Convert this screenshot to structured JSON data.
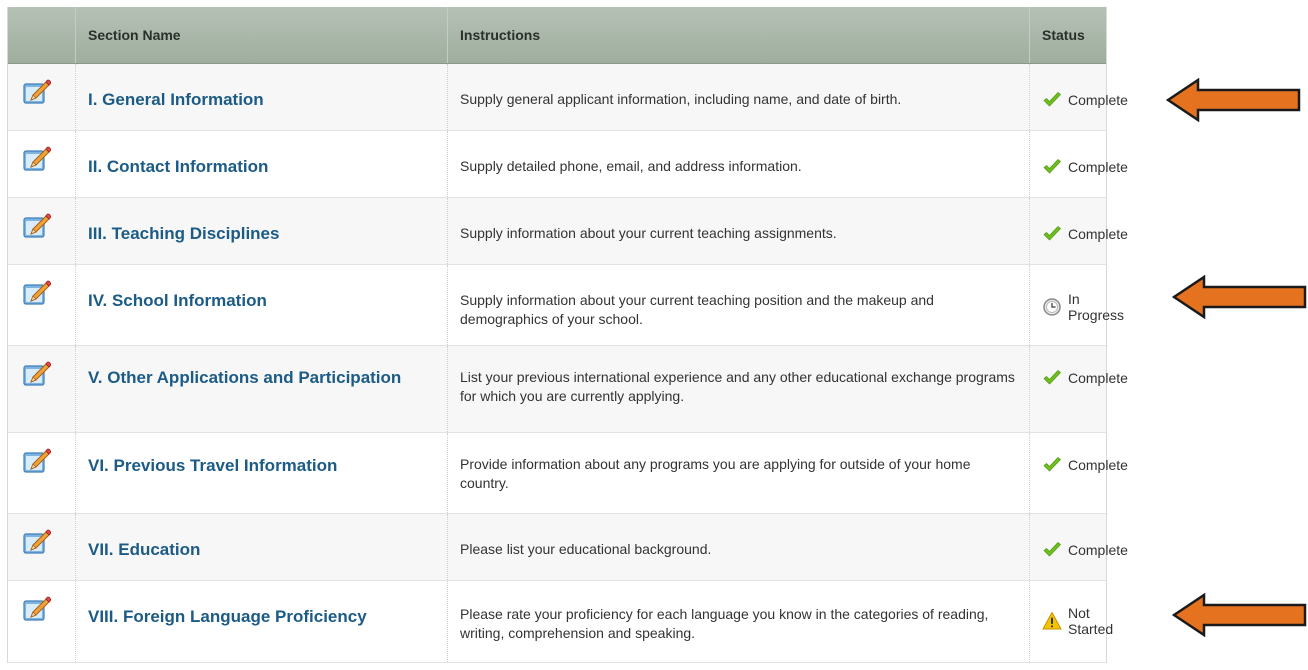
{
  "table": {
    "headers": {
      "icon": "",
      "section": "Section Name",
      "instructions": "Instructions",
      "status": "Status"
    },
    "rows": [
      {
        "section": "I. General Information",
        "instructions": "Supply general applicant information, including name, and date of birth.",
        "status": "Complete",
        "status_icon": "checkmark-icon"
      },
      {
        "section": "II. Contact Information",
        "instructions": "Supply detailed phone, email, and address information.",
        "status": "Complete",
        "status_icon": "checkmark-icon"
      },
      {
        "section": "III. Teaching Disciplines",
        "instructions": "Supply information about your current teaching assignments.",
        "status": "Complete",
        "status_icon": "checkmark-icon"
      },
      {
        "section": "IV. School Information",
        "instructions": "Supply information about your current teaching position and the makeup and demographics of your school.",
        "status": "In Progress",
        "status_icon": "clock-icon"
      },
      {
        "section": "V. Other Applications and Participation",
        "instructions": "List your previous international experience and any other educational exchange programs for which you are currently applying.",
        "status": "Complete",
        "status_icon": "checkmark-icon"
      },
      {
        "section": "VI. Previous Travel Information",
        "instructions": "Provide information about any programs you are applying for outside of your home country.",
        "status": "Complete",
        "status_icon": "checkmark-icon"
      },
      {
        "section": "VII. Education",
        "instructions": "Please list your educational background.",
        "status": "Complete",
        "status_icon": "checkmark-icon"
      },
      {
        "section": "VIII. Foreign Language Proficiency",
        "instructions": "Please rate your proficiency for each language you know in the categories of reading, writing, comprehension and speaking.",
        "status": "Not Started",
        "status_icon": "warning-icon"
      }
    ]
  },
  "colors": {
    "header_bg": "#a6b4a6",
    "link": "#1b5b86",
    "check": "#6fbf1e",
    "arrow": "#e4721f",
    "warning": "#f5c400"
  }
}
